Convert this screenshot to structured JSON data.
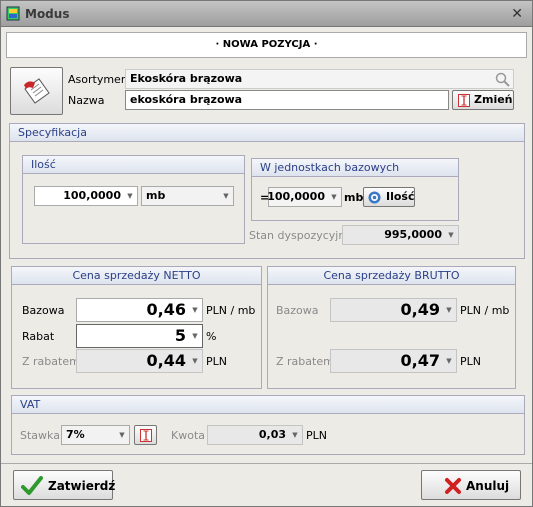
{
  "window": {
    "title": "Modus"
  },
  "header": {
    "title": "· NOWA POZYCJA ·"
  },
  "item": {
    "asortyment_label": "Asortyment",
    "asortyment_value": "Ekoskóra brązowa",
    "nazwa_label": "Nazwa",
    "nazwa_value": "ekoskóra brązowa",
    "change_button": "Zmień"
  },
  "spec": {
    "title": "Specyfikacja",
    "ilosc": {
      "title": "Ilość",
      "value": "100,0000",
      "unit": "mb"
    },
    "base": {
      "title": "W jednostkach bazowych",
      "eq": "=",
      "value": "100,0000",
      "unit": "mb",
      "button": "Ilość"
    },
    "stan": {
      "label": "Stan dyspozycyjny",
      "value": "995,0000"
    }
  },
  "netto": {
    "title": "Cena sprzedaży NETTO",
    "bazowa_label": "Bazowa",
    "bazowa_value": "0,46",
    "bazowa_unit": "PLN / mb",
    "rabat_label": "Rabat",
    "rabat_value": "5",
    "rabat_unit": "%",
    "zrab_label": "Z rabatem",
    "zrab_value": "0,44",
    "zrab_unit": "PLN"
  },
  "brutto": {
    "title": "Cena sprzedaży BRUTTO",
    "bazowa_label": "Bazowa",
    "bazowa_value": "0,49",
    "bazowa_unit": "PLN / mb",
    "zrab_label": "Z rabatem",
    "zrab_value": "0,47",
    "zrab_unit": "PLN"
  },
  "vat": {
    "title": "VAT",
    "stawka_label": "Stawka",
    "stawka_value": "7%",
    "kwota_label": "Kwota",
    "kwota_value": "0,03",
    "kwota_unit": "PLN"
  },
  "footer": {
    "confirm": "Zatwierdź",
    "cancel": "Anuluj"
  },
  "colors": {
    "group_header": "#2a3f86",
    "confirm_icon": "#2e9a2e",
    "cancel_icon": "#d02020"
  }
}
